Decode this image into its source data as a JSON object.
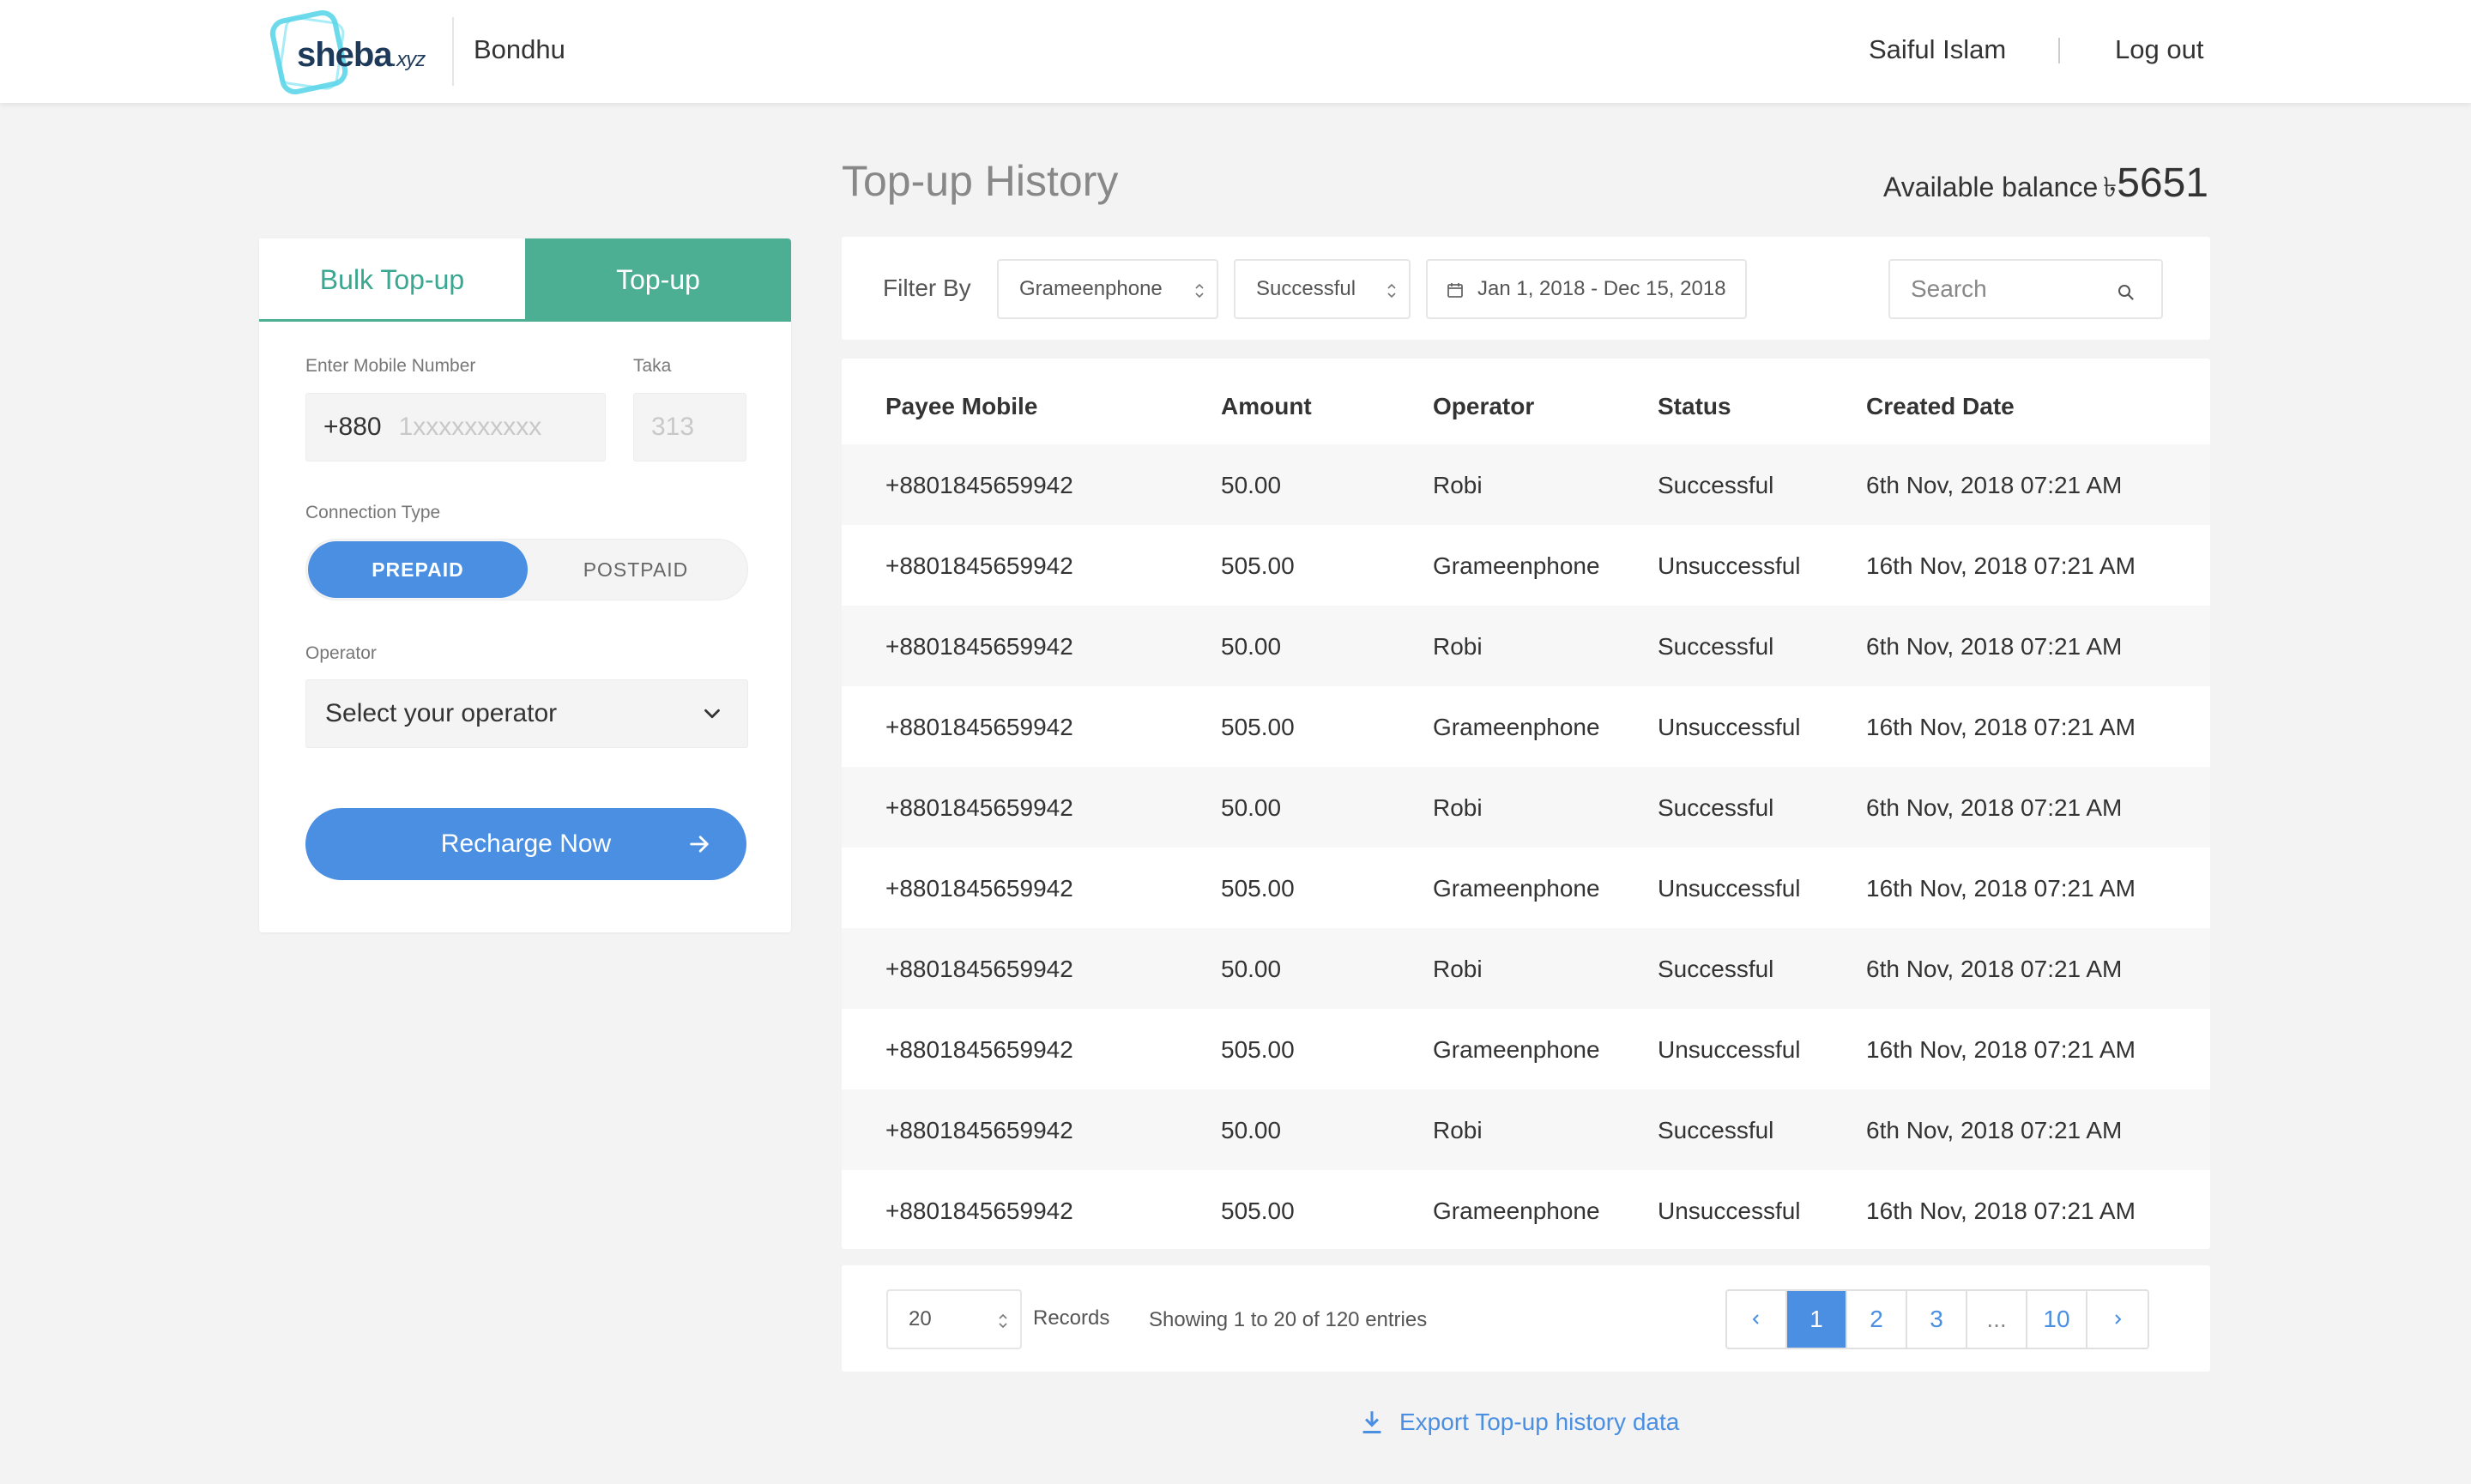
{
  "header": {
    "logo_text": "sheba",
    "logo_suffix": ".xyz",
    "brand": "Bondhu",
    "user_name": "Saiful Islam",
    "logout_label": "Log out"
  },
  "panel": {
    "tabs": [
      {
        "label": "Bulk Top-up",
        "active": false
      },
      {
        "label": "Top-up",
        "active": true
      }
    ],
    "mobile_label": "Enter Mobile Number",
    "mobile_prefix": "+880",
    "mobile_placeholder": "1xxxxxxxxxx",
    "taka_label": "Taka",
    "taka_placeholder": "313",
    "connection_label": "Connection Type",
    "connection_options": [
      {
        "label": "PREPAID",
        "selected": true
      },
      {
        "label": "POSTPAID",
        "selected": false
      }
    ],
    "operator_label": "Operator",
    "operator_value": "Select your operator",
    "recharge_label": "Recharge Now"
  },
  "main": {
    "title": "Top-up History",
    "balance_label": "Available balance",
    "balance_currency": "৳",
    "balance_amount": "5651"
  },
  "filters": {
    "label": "Filter By",
    "operator": "Grameenphone",
    "status": "Successful",
    "date_range": "Jan 1, 2018 - Dec 15, 2018",
    "search_placeholder": "Search"
  },
  "table": {
    "columns": [
      "Payee Mobile",
      "Amount",
      "Operator",
      "Status",
      "Created Date"
    ],
    "rows": [
      [
        "+8801845659942",
        "50.00",
        "Robi",
        "Successful",
        "6th Nov, 2018 07:21 AM"
      ],
      [
        "+8801845659942",
        "505.00",
        "Grameenphone",
        "Unsuccessful",
        "16th Nov, 2018 07:21 AM"
      ],
      [
        "+8801845659942",
        "50.00",
        "Robi",
        "Successful",
        "6th Nov, 2018 07:21 AM"
      ],
      [
        "+8801845659942",
        "505.00",
        "Grameenphone",
        "Unsuccessful",
        "16th Nov, 2018 07:21 AM"
      ],
      [
        "+8801845659942",
        "50.00",
        "Robi",
        "Successful",
        "6th Nov, 2018 07:21 AM"
      ],
      [
        "+8801845659942",
        "505.00",
        "Grameenphone",
        "Unsuccessful",
        "16th Nov, 2018 07:21 AM"
      ],
      [
        "+8801845659942",
        "50.00",
        "Robi",
        "Successful",
        "6th Nov, 2018 07:21 AM"
      ],
      [
        "+8801845659942",
        "505.00",
        "Grameenphone",
        "Unsuccessful",
        "16th Nov, 2018 07:21 AM"
      ],
      [
        "+8801845659942",
        "50.00",
        "Robi",
        "Successful",
        "6th Nov, 2018 07:21 AM"
      ],
      [
        "+8801845659942",
        "505.00",
        "Grameenphone",
        "Unsuccessful",
        "16th Nov, 2018 07:21 AM"
      ]
    ]
  },
  "pagination": {
    "records_per_page": "20",
    "records_label": "Records",
    "showing_text": "Showing 1 to 20 of 120 entries",
    "pages": [
      "1",
      "2",
      "3",
      "...",
      "10"
    ],
    "current_page": "1"
  },
  "export_label": "Export Top-up history data",
  "colors": {
    "accent_green": "#4caf93",
    "accent_blue": "#4a8fe2",
    "background": "#f3f3f3"
  }
}
